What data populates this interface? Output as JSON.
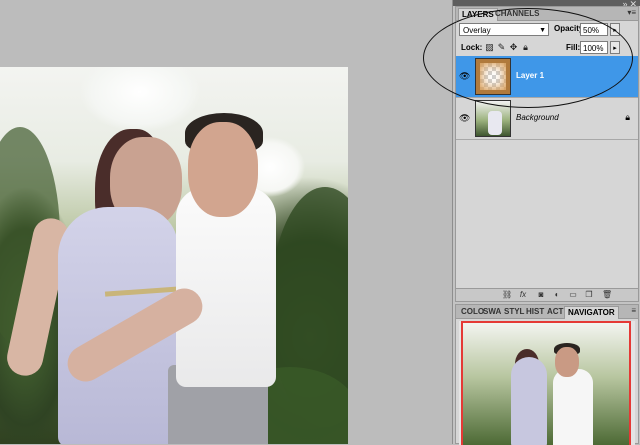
{
  "layers_panel": {
    "tabs": [
      "LAYERS",
      "CHANNELS"
    ],
    "blend_mode": "Overlay",
    "opacity_label": "Opacity:",
    "opacity_value": "50%",
    "lock_label": "Lock:",
    "fill_label": "Fill:",
    "fill_value": "100%",
    "layers": [
      {
        "name": "Layer 1",
        "selected": true,
        "visible": true
      },
      {
        "name": "Background",
        "selected": false,
        "visible": true,
        "locked": true
      }
    ],
    "footer_icons": [
      "link-icon",
      "fx-icon",
      "mask-icon",
      "adjustment-icon",
      "group-icon",
      "new-layer-icon",
      "trash-icon"
    ]
  },
  "navigator_panel": {
    "tabs": [
      "COLO",
      "SWA",
      "STYL",
      "HIST",
      "ACTI",
      "NAVIGATOR"
    ]
  },
  "colors": {
    "selected_layer": "#3f97e8",
    "navigator_box": "#e53935",
    "canvas_bg": "#bcbcbc"
  }
}
